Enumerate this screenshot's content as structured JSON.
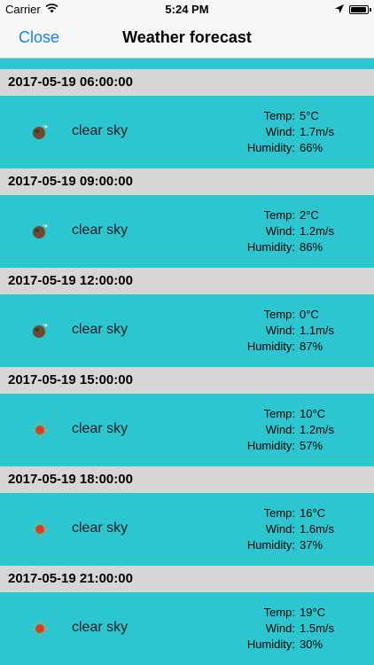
{
  "status_bar": {
    "carrier": "Carrier",
    "time": "5:24 PM"
  },
  "nav": {
    "close_label": "Close",
    "title": "Weather forecast"
  },
  "labels": {
    "temp": "Temp:",
    "wind": "Wind:",
    "humidity": "Humidity:"
  },
  "forecasts": [
    {
      "datetime": "2017-05-19 06:00:00",
      "description": "clear sky",
      "icon": "moon-icon",
      "temp": "5°C",
      "wind": "1.7m/s",
      "humidity": "66%"
    },
    {
      "datetime": "2017-05-19 09:00:00",
      "description": "clear sky",
      "icon": "moon-icon",
      "temp": "2°C",
      "wind": "1.2m/s",
      "humidity": "86%"
    },
    {
      "datetime": "2017-05-19 12:00:00",
      "description": "clear sky",
      "icon": "moon-icon",
      "temp": "0°C",
      "wind": "1.1m/s",
      "humidity": "87%"
    },
    {
      "datetime": "2017-05-19 15:00:00",
      "description": "clear sky",
      "icon": "sun-icon",
      "temp": "10°C",
      "wind": "1.2m/s",
      "humidity": "57%"
    },
    {
      "datetime": "2017-05-19 18:00:00",
      "description": "clear sky",
      "icon": "sun-icon",
      "temp": "16°C",
      "wind": "1.6m/s",
      "humidity": "37%"
    },
    {
      "datetime": "2017-05-19 21:00:00",
      "description": "clear sky",
      "icon": "sun-icon",
      "temp": "19°C",
      "wind": "1.5m/s",
      "humidity": "30%"
    }
  ],
  "colors": {
    "row_background": "#2bc6cf",
    "header_background": "#d6d6d6",
    "accent": "#1d7ff2"
  }
}
